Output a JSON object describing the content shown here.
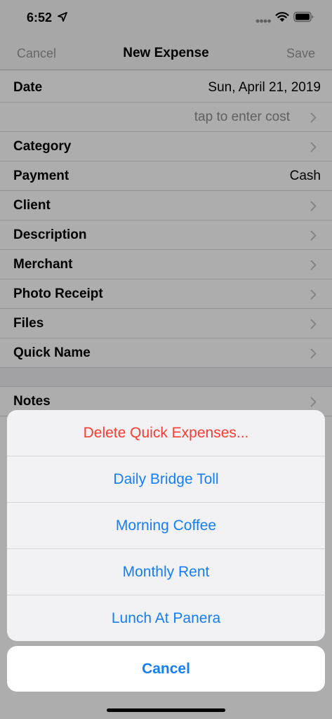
{
  "status_bar": {
    "time": "6:52"
  },
  "nav": {
    "cancel_label": "Cancel",
    "title": "New Expense",
    "save_label": "Save"
  },
  "form": {
    "rows": [
      {
        "label": "Date",
        "value": "Sun,  April 21, 2019"
      },
      {
        "label": "",
        "value": "tap to enter cost"
      },
      {
        "label": "Category",
        "value": ""
      },
      {
        "label": "Payment",
        "value": "Cash"
      },
      {
        "label": "Client",
        "value": ""
      },
      {
        "label": "Description",
        "value": ""
      },
      {
        "label": "Merchant",
        "value": ""
      },
      {
        "label": "Photo Receipt",
        "value": ""
      },
      {
        "label": "Files",
        "value": ""
      },
      {
        "label": "Quick Name",
        "value": ""
      }
    ],
    "notes_label": "Notes"
  },
  "action_sheet": {
    "items": [
      {
        "label": "Delete Quick Expenses..."
      },
      {
        "label": "Daily Bridge Toll"
      },
      {
        "label": "Morning Coffee"
      },
      {
        "label": "Monthly Rent"
      },
      {
        "label": "Lunch At Panera"
      }
    ],
    "cancel_label": "Cancel"
  },
  "colors": {
    "action_blue": "#147efb",
    "destructive_red": "#ff3b30"
  },
  "icons": {
    "location": "location-arrow-icon",
    "signal": "cellular-signal-icon",
    "wifi": "wifi-icon",
    "battery": "battery-icon",
    "chevron": "chevron-right-icon"
  }
}
